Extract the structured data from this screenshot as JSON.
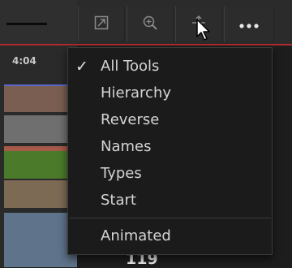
{
  "toolbar": {
    "icons": [
      "expand-icon",
      "zoom-icon",
      "crosshair-icon",
      "more-icon"
    ]
  },
  "timeline": {
    "time_label": "4:04",
    "bottom_value": "119"
  },
  "menu": {
    "items": [
      {
        "label": "All Tools",
        "checked": true
      },
      {
        "label": "Hierarchy"
      },
      {
        "label": "Reverse"
      },
      {
        "label": "Names"
      },
      {
        "label": "Types"
      },
      {
        "label": "Start"
      },
      {
        "label": "Animated"
      }
    ],
    "check_glyph": "✓"
  },
  "colors": {
    "accent_red": "#b22b2b",
    "track_brown": "#7a5e52",
    "track_gray": "#6f6f6f",
    "track_green": "#4b7a2a",
    "track_tan": "#7d6a55",
    "track_blue": "#5f738a"
  }
}
